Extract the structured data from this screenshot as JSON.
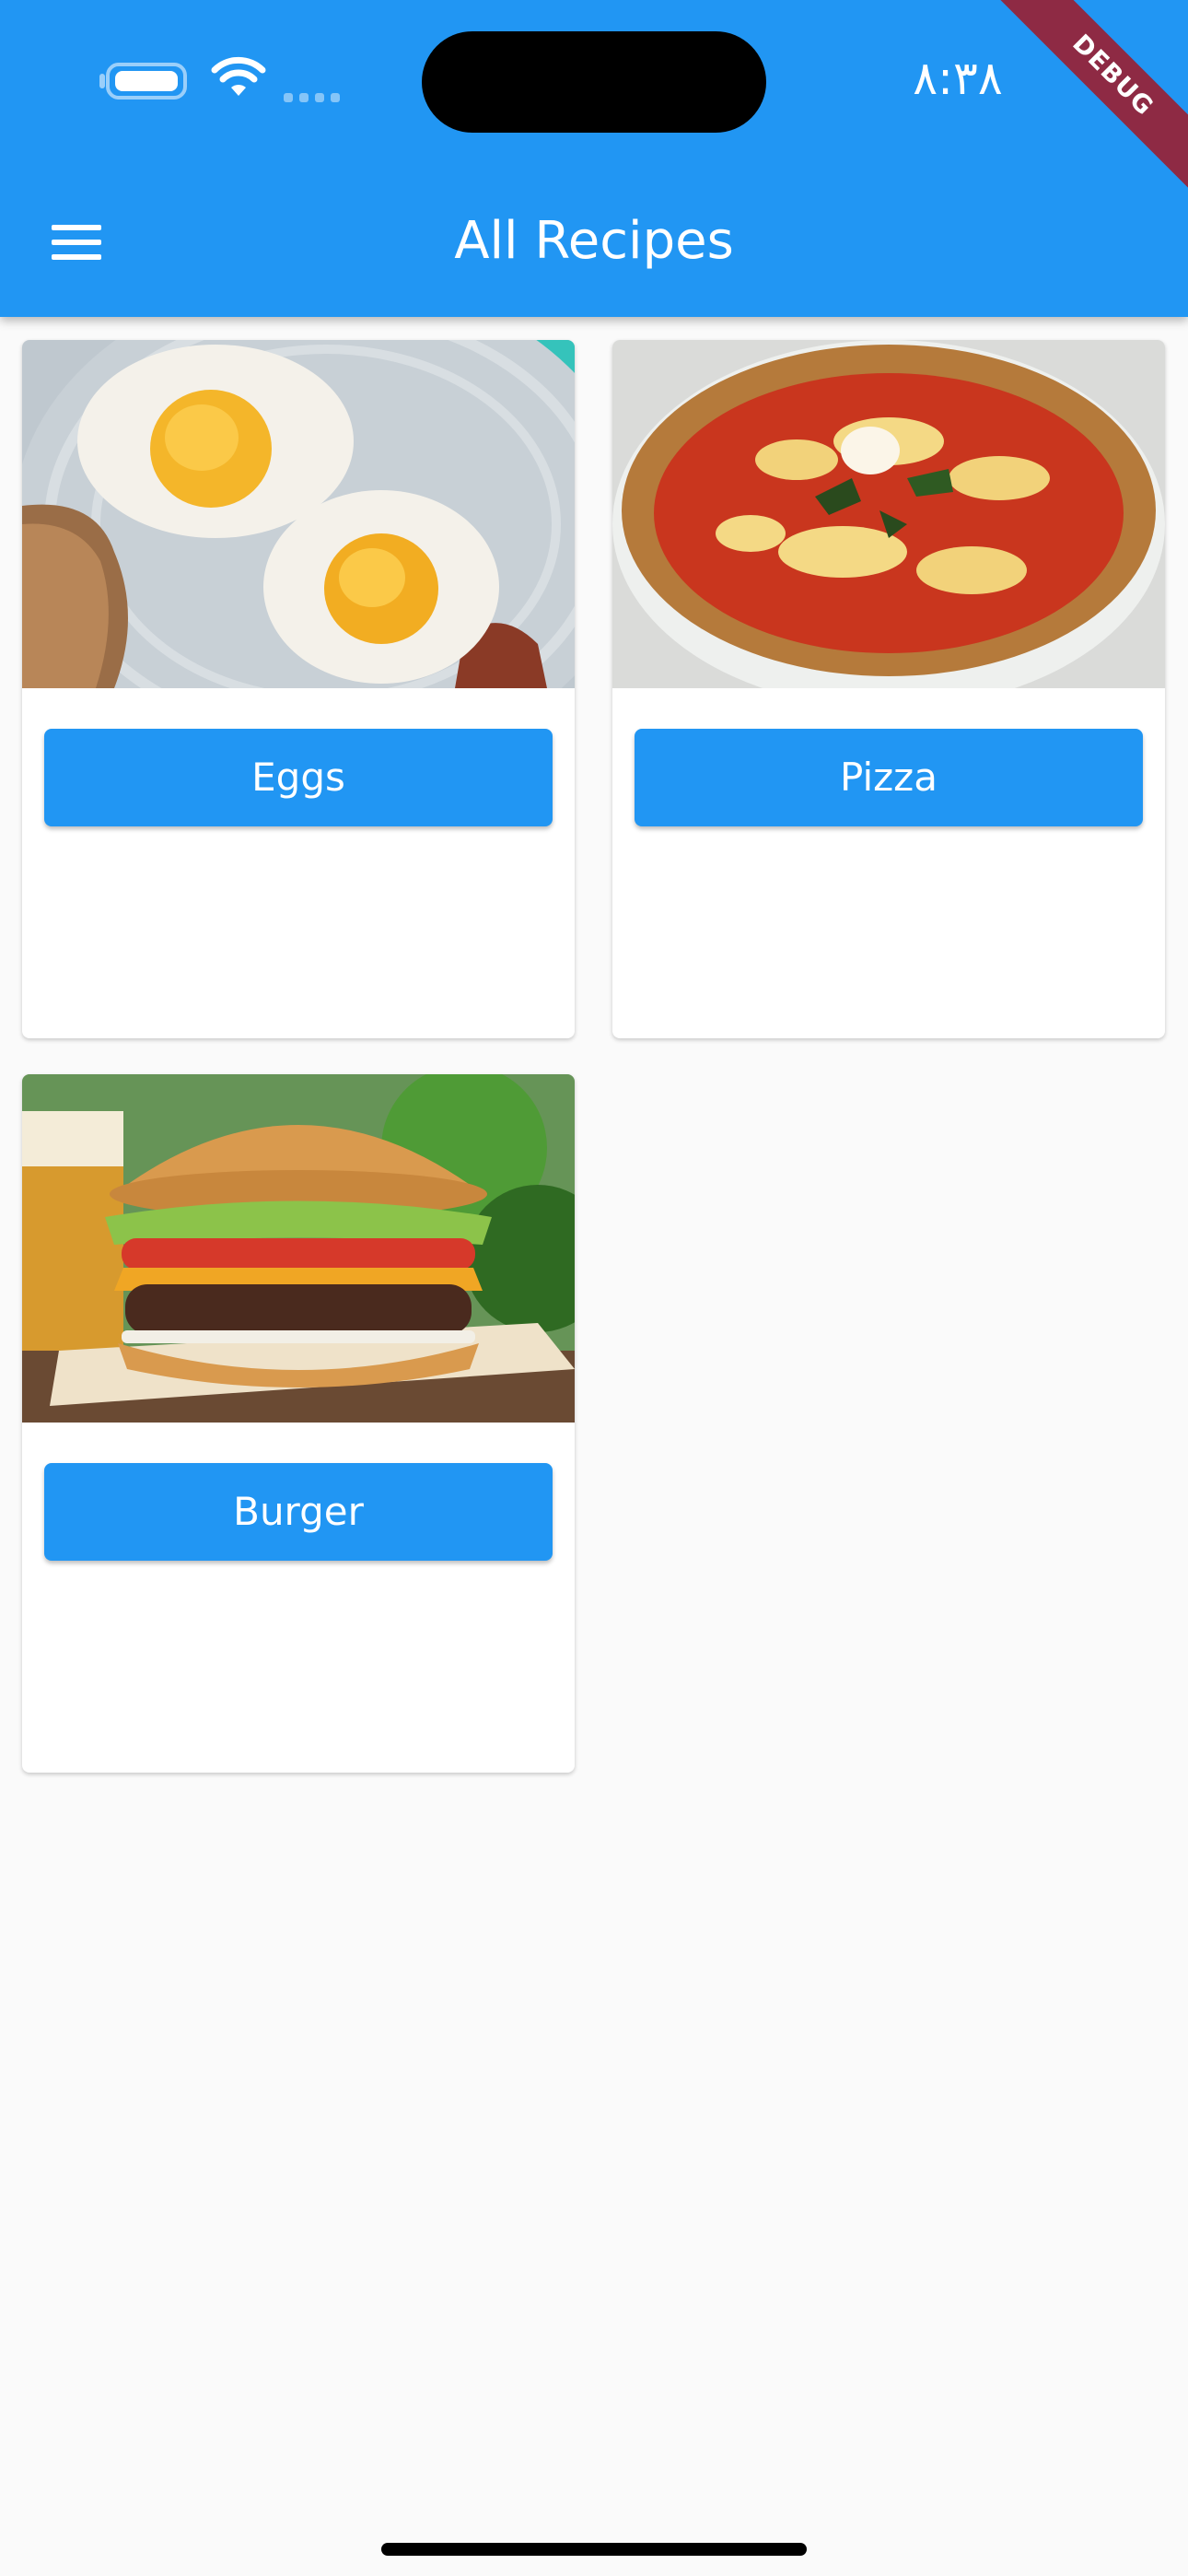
{
  "status_bar": {
    "time": "٨:٣٨",
    "battery_icon": "battery-icon",
    "wifi_icon": "wifi-icon",
    "signal_icon": "cellular-signal-icon"
  },
  "debug_banner": {
    "label": "DEBUG",
    "color": "#8e2a44"
  },
  "app_bar": {
    "title": "All Recipes",
    "menu_icon": "menu-icon",
    "background": "#2196f3"
  },
  "recipes": [
    {
      "label": "Eggs",
      "image": "fried-eggs-photo"
    },
    {
      "label": "Pizza",
      "image": "margherita-pizza-photo"
    },
    {
      "label": "Burger",
      "image": "cheeseburger-photo"
    }
  ]
}
